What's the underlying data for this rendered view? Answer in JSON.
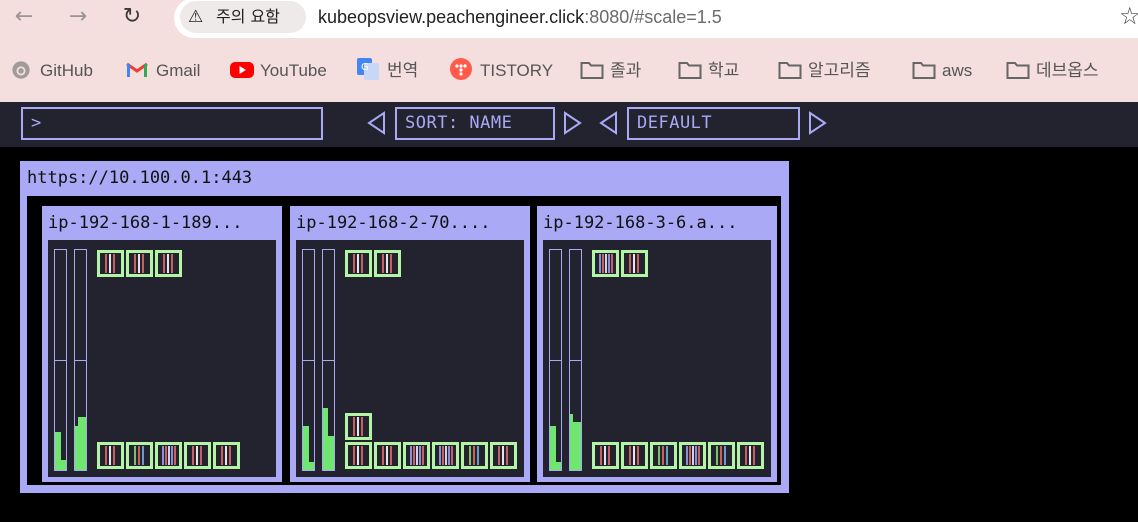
{
  "browser": {
    "security_label": "주의 요함",
    "url_host": "kubeopsview.peachengineer.click",
    "url_rest": ":8080/#scale=1.5",
    "bookmarks": [
      {
        "label": "GitHub",
        "icon": "github-icon"
      },
      {
        "label": "Gmail",
        "icon": "gmail-icon"
      },
      {
        "label": "YouTube",
        "icon": "youtube-icon"
      },
      {
        "label": "번역",
        "icon": "translate-icon"
      },
      {
        "label": "TISTORY",
        "icon": "tistory-icon"
      },
      {
        "label": "졸과",
        "icon": "folder-icon"
      },
      {
        "label": "학교",
        "icon": "folder-icon"
      },
      {
        "label": "알고리즘",
        "icon": "folder-icon"
      },
      {
        "label": "aws",
        "icon": "folder-icon"
      },
      {
        "label": "데브옵스",
        "icon": "folder-icon"
      }
    ]
  },
  "toolbar": {
    "filter_value": ">",
    "sort_label": "SORT: NAME",
    "theme_label": "DEFAULT"
  },
  "cluster": {
    "title": "https://10.100.0.1:443",
    "nodes": [
      {
        "title": "ip-192-168-1-189...",
        "cpu_level": 0.17,
        "mem_level": 0.24
      },
      {
        "title": "ip-192-168-2-70....",
        "cpu_level": 0.2,
        "mem_level": 0.28
      },
      {
        "title": "ip-192-168-3-6.a...",
        "cpu_level": 0.2,
        "mem_level": 0.25
      }
    ]
  },
  "colors": {
    "accent": "#aaa9f5",
    "pod_border": "#b4f5a5",
    "gauge_fill": "#6ee670",
    "panel": "#23222f"
  }
}
